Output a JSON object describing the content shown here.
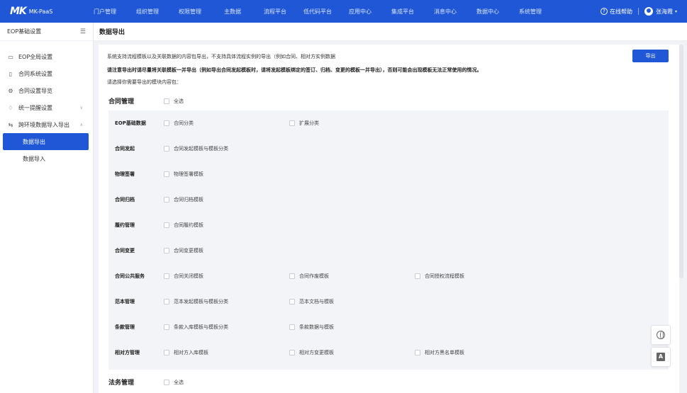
{
  "app": {
    "logo_mark": "MK",
    "logo_text": "MK-PaaS"
  },
  "nav": [
    "门户管理",
    "组织管理",
    "权限管理",
    "主数据",
    "流程平台",
    "低代码平台",
    "应用中心",
    "集成平台",
    "消息中心",
    "数据中心",
    "系统管理"
  ],
  "topright": {
    "help": "在线帮助",
    "user": "张海霞"
  },
  "sidebar": {
    "header": "EOP基础设置",
    "items": [
      {
        "label": "EOP全局设置",
        "icon": "monitor-icon"
      },
      {
        "label": "合同系统设置",
        "icon": "file-settings-icon"
      },
      {
        "label": "合同设置导览",
        "icon": "gear-icon"
      },
      {
        "label": "统一提醒设置",
        "icon": "bell-icon"
      },
      {
        "label": "跨环境数据导入导出",
        "icon": "transfer-icon"
      }
    ],
    "subitems": [
      "数据导出",
      "数据导入"
    ]
  },
  "page": {
    "title": "数据导出",
    "desc1": "系统支持流程模板以及关联数据的内容包导出，不支持具体流程实例的导出（例如合同、相对方实例数据",
    "desc2": "请注意导出时请尽量将关联模板一并导出（例如导出合同发起模板时，请将发起模板绑定的签订、归档、变更的模板一并导出），否则可能会出现模板无法正常使用的情况。",
    "desc3": "请选择你需要导出的模块内容包：",
    "export_label": "导出"
  },
  "groups": [
    {
      "title": "合同管理",
      "select_all": "全选"
    },
    {
      "title": "法务管理",
      "select_all": "全选"
    }
  ],
  "rows": [
    {
      "label": "EOP基础数据",
      "options": [
        "合同分类",
        "扩展分类"
      ]
    },
    {
      "label": "合同发起",
      "options": [
        "合同发起模板与模板分类"
      ]
    },
    {
      "label": "物理签署",
      "options": [
        "物理签署模板"
      ]
    },
    {
      "label": "合同归档",
      "options": [
        "合同归档模板"
      ]
    },
    {
      "label": "履约管理",
      "options": [
        "合同履约模板"
      ]
    },
    {
      "label": "合同变更",
      "options": [
        "合同变更模板"
      ]
    },
    {
      "label": "合同公共服务",
      "options": [
        "合同关闭模板",
        "合同作废模板",
        "合同授权流程模板"
      ]
    },
    {
      "label": "范本管理",
      "options": [
        "范本发起模板与模板分类",
        "范本文档与模板"
      ]
    },
    {
      "label": "条款管理",
      "options": [
        "条款入库模板与模板分类",
        "条款数据与模板"
      ]
    },
    {
      "label": "相对方管理",
      "options": [
        "相对方入库模板",
        "相对方变更模板",
        "相对方黑名单模板"
      ]
    }
  ],
  "colors": {
    "primary": "#1f57d6",
    "grid_bg": "#f3f4f7"
  }
}
